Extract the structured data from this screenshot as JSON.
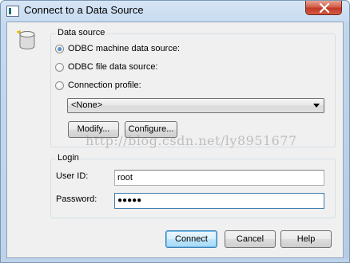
{
  "window": {
    "title": "Connect to a Data Source",
    "close_icon": "close-icon",
    "title_icon": "window-app-icon"
  },
  "icon": {
    "name": "database-icon"
  },
  "data_source": {
    "legend": "Data source",
    "options": [
      {
        "label": "ODBC machine data source:",
        "checked": true
      },
      {
        "label": "ODBC file data source:",
        "checked": false
      },
      {
        "label": "Connection profile:",
        "checked": false
      }
    ],
    "profile_select": {
      "value": "<None>"
    },
    "modify_label": "Modify...",
    "configure_label": "Configure..."
  },
  "login": {
    "legend": "Login",
    "user_id_label": "User ID:",
    "user_id_value": "root",
    "password_label": "Password:",
    "password_masked": "●●●●●"
  },
  "buttons": {
    "connect": "Connect",
    "cancel": "Cancel",
    "help": "Help"
  },
  "watermark": "http://blog.csdn.net/ly8951677",
  "colors": {
    "accent": "#3c7fb1",
    "radio_dot": "#1f5fa8",
    "close_button": "#c0392b"
  }
}
